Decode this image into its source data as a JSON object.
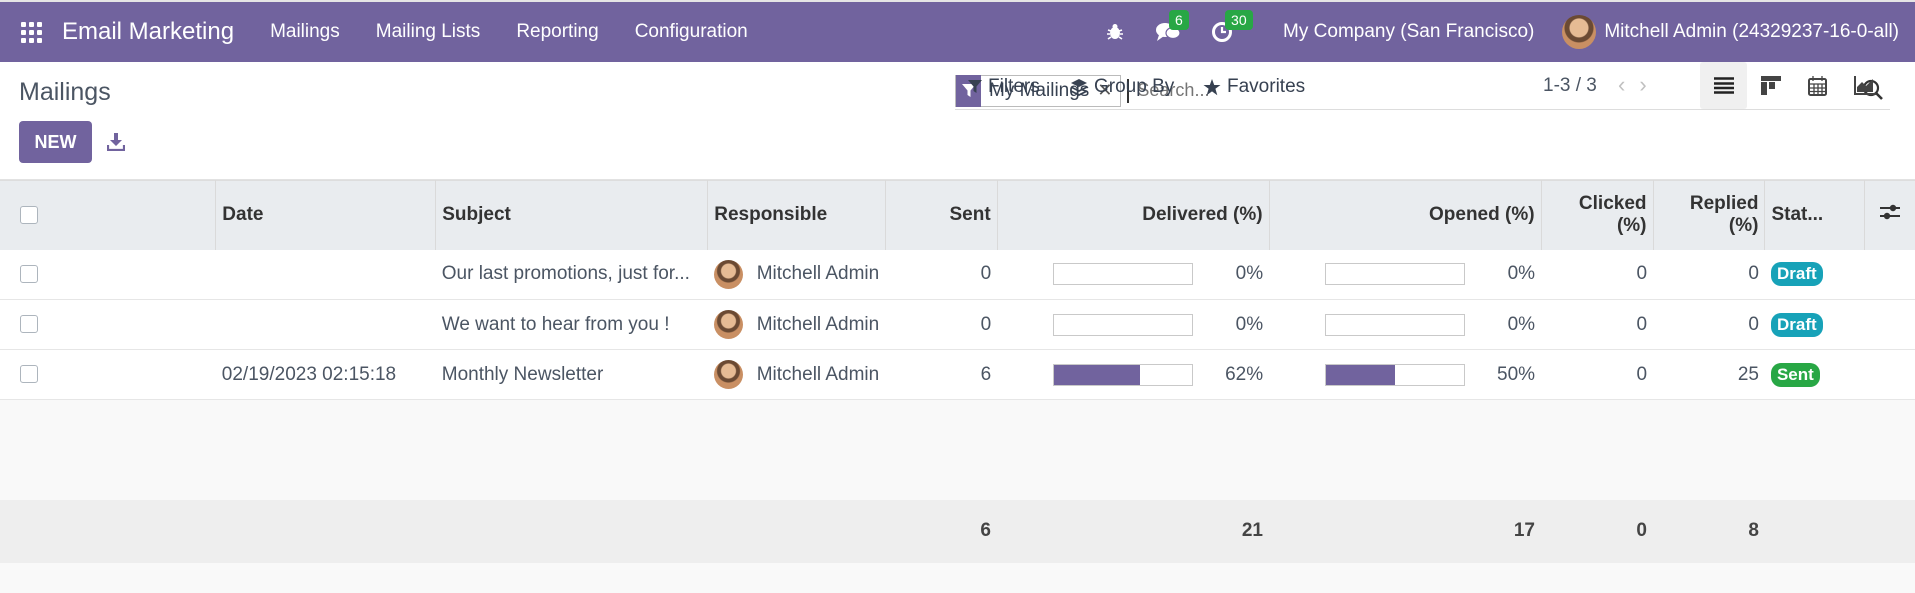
{
  "app": {
    "title": "Email Marketing"
  },
  "nav": {
    "menu": [
      "Mailings",
      "Mailing Lists",
      "Reporting",
      "Configuration"
    ]
  },
  "systray": {
    "messages_count": "6",
    "activities_count": "30",
    "company": "My Company (San Francisco)",
    "user": "Mitchell Admin (24329237-16-0-all)"
  },
  "page": {
    "breadcrumb": "Mailings",
    "new_label": "NEW"
  },
  "search": {
    "facet": "My Mailings",
    "placeholder": "Search..."
  },
  "filters": {
    "filters_label": "Filters",
    "groupby_label": "Group By",
    "favorites_label": "Favorites"
  },
  "pager": {
    "value": "1-3 / 3"
  },
  "table": {
    "headers": {
      "date": "Date",
      "subject": "Subject",
      "responsible": "Responsible",
      "sent": "Sent",
      "delivered": "Delivered (%)",
      "opened": "Opened (%)",
      "clicked": "Clicked (%)",
      "replied": "Replied (%)",
      "status": "Stat..."
    },
    "rows": [
      {
        "date": "",
        "subject": "Our last promotions, just for...",
        "responsible": "Mitchell Admin",
        "sent": "0",
        "delivered": 0,
        "delivered_label": "0%",
        "opened": 0,
        "opened_label": "0%",
        "clicked": "0",
        "replied": "0",
        "status": "Draft",
        "status_color": "#17a2b8"
      },
      {
        "date": "",
        "subject": "We want to hear from you !",
        "responsible": "Mitchell Admin",
        "sent": "0",
        "delivered": 0,
        "delivered_label": "0%",
        "opened": 0,
        "opened_label": "0%",
        "clicked": "0",
        "replied": "0",
        "status": "Draft",
        "status_color": "#17a2b8"
      },
      {
        "date": "02/19/2023 02:15:18",
        "subject": "Monthly Newsletter",
        "responsible": "Mitchell Admin",
        "sent": "6",
        "delivered": 62,
        "delivered_label": "62%",
        "opened": 50,
        "opened_label": "50%",
        "clicked": "0",
        "replied": "25",
        "status": "Sent",
        "status_color": "#28a745"
      }
    ],
    "totals": {
      "sent": "6",
      "delivered": "21",
      "opened": "17",
      "clicked": "0",
      "replied": "8"
    }
  },
  "colors": {
    "brand": "#71639e"
  }
}
